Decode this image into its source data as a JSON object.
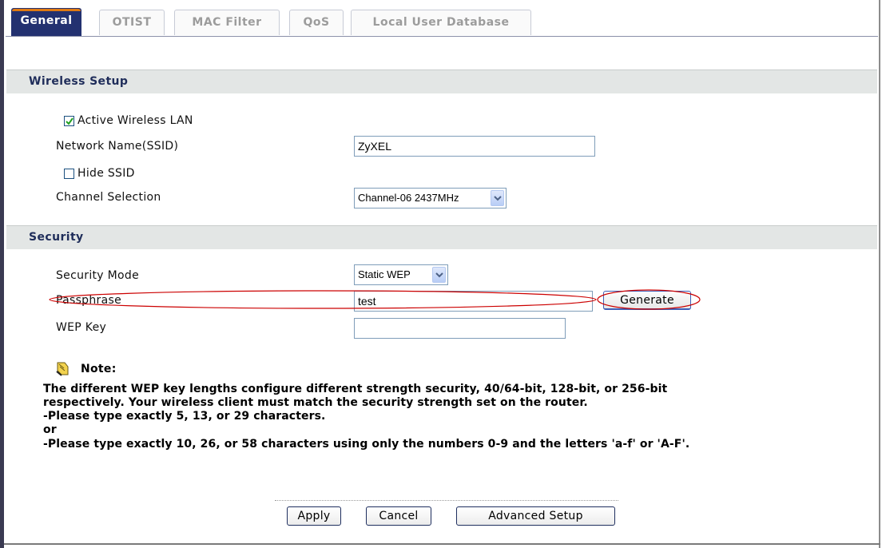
{
  "tabs": [
    "General",
    "OTIST",
    "MAC Filter",
    "QoS",
    "Local User Database"
  ],
  "wireless_setup": {
    "heading": "Wireless Setup",
    "active_wireless_lan": {
      "label": "Active Wireless LAN",
      "checked": true
    },
    "ssid": {
      "label": "Network Name(SSID)",
      "value": "ZyXEL"
    },
    "hide_ssid": {
      "label": "Hide SSID",
      "checked": false
    },
    "channel": {
      "label": "Channel Selection",
      "value": "Channel-06 2437MHz"
    }
  },
  "security": {
    "heading": "Security",
    "mode": {
      "label": "Security Mode",
      "value": "Static WEP"
    },
    "passphrase": {
      "label": "Passphrase",
      "value": "test"
    },
    "generate_label": "Generate",
    "wep_key": {
      "label": "WEP Key",
      "value": ""
    }
  },
  "note": {
    "title": "Note:",
    "lines": [
      "The different WEP key lengths configure different strength security, 40/64-bit, 128-bit, or 256-bit",
      "respectively. Your wireless client must match the security strength set on the router.",
      "-Please type exactly 5, 13, or 29 characters.",
      "or",
      "-Please type exactly 10, 26, or 58 characters using only the numbers 0-9 and the letters 'a-f' or 'A-F'."
    ]
  },
  "buttons": {
    "apply": "Apply",
    "cancel": "Cancel",
    "advanced": "Advanced Setup"
  },
  "colors": {
    "tab_active": "#233170",
    "section_bar": "#e3e6e5",
    "annotation": "#cc0000"
  },
  "icons": {
    "note": "note-hand-icon",
    "dropdown": "chevron-down-icon",
    "check": "checkmark-icon"
  }
}
